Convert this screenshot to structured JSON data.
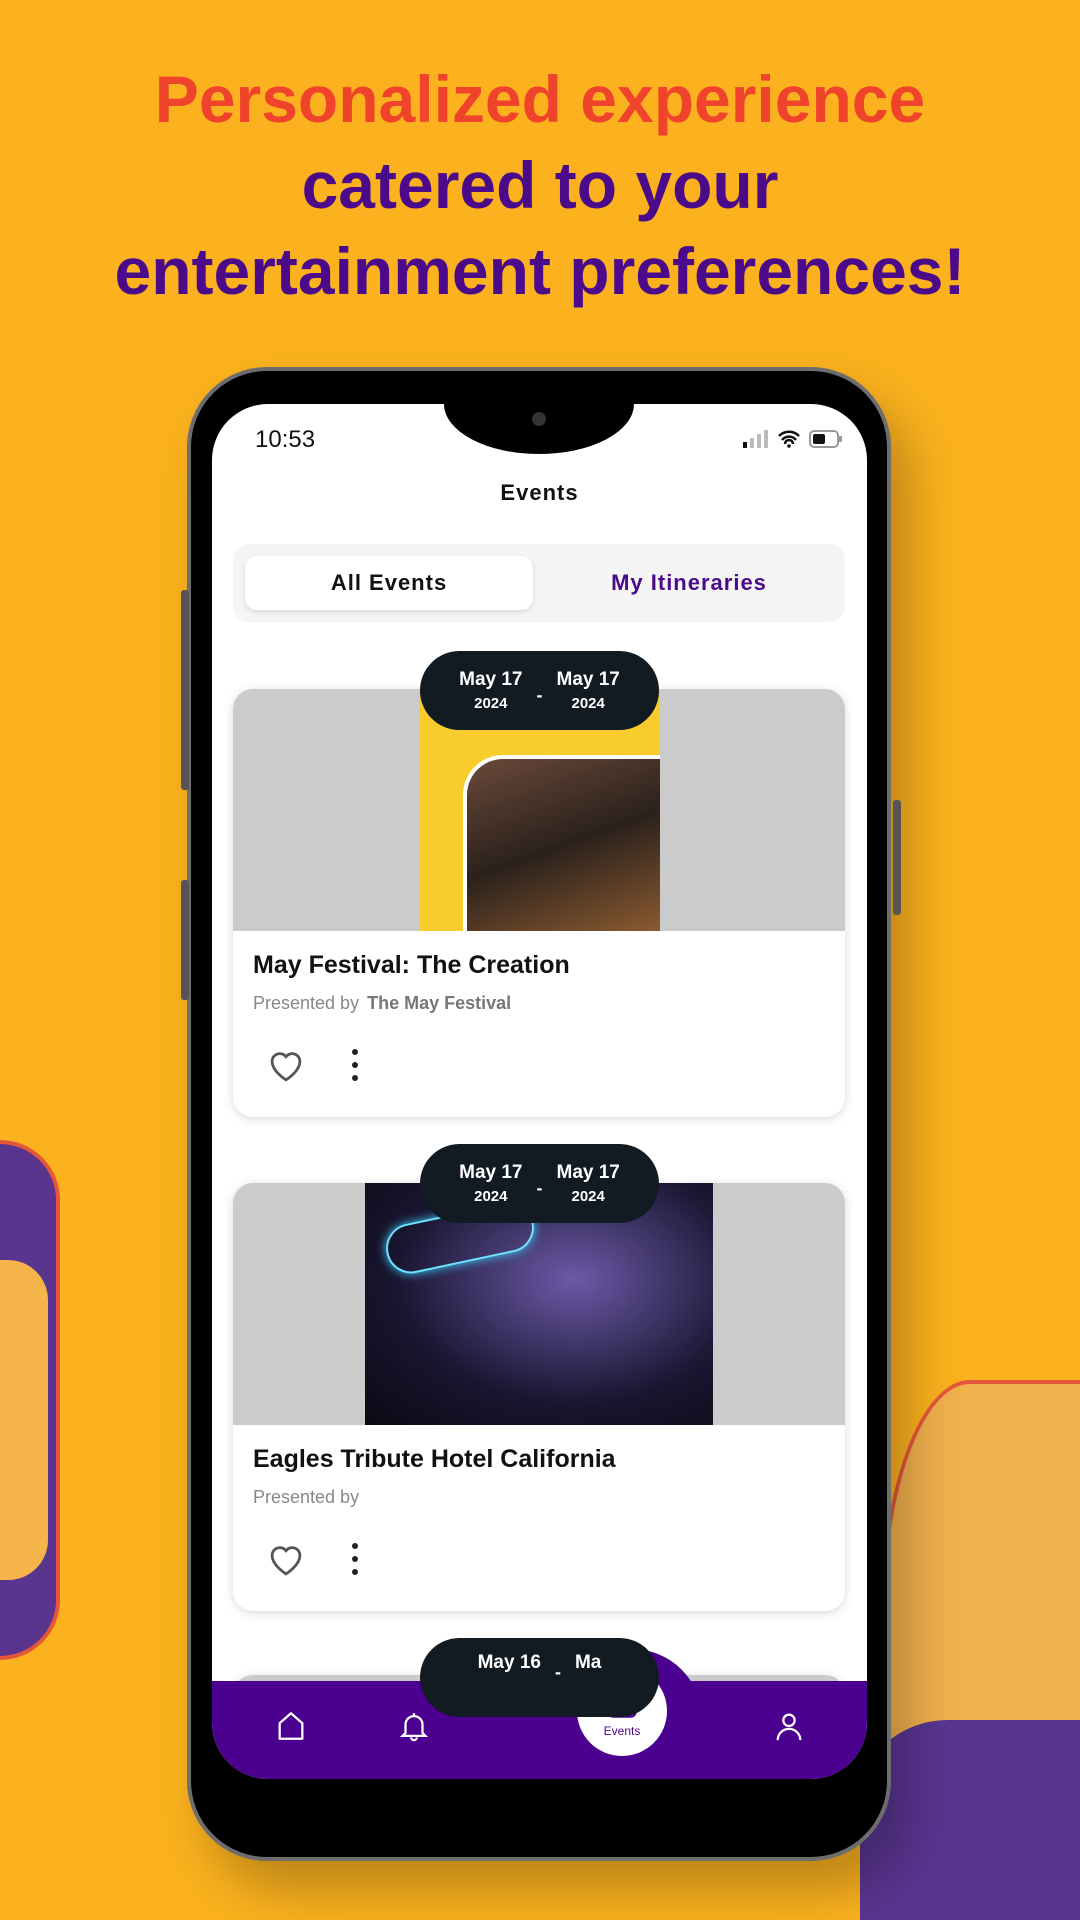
{
  "headline": {
    "line1": "Personalized experience",
    "line2": "catered to your",
    "line3": "entertainment preferences!"
  },
  "status_bar": {
    "time": "10:53"
  },
  "header": {
    "title": "Events"
  },
  "tabs": [
    {
      "label": "All Events",
      "active": true
    },
    {
      "label": "My Itineraries",
      "active": false
    }
  ],
  "events": [
    {
      "start_month_day": "May 17",
      "start_year": "2024",
      "end_month_day": "May 17",
      "end_year": "2024",
      "title": "May Festival: The Creation",
      "presented_by_label": "Presented by",
      "presenter": "The May Festival"
    },
    {
      "start_month_day": "May 17",
      "start_year": "2024",
      "end_month_day": "May 17",
      "end_year": "2024",
      "title": "Eagles Tribute Hotel California",
      "presented_by_label": "Presented by",
      "presenter": ""
    },
    {
      "start_month_day": "May 16",
      "end_month_day": "Ma"
    }
  ],
  "bottom_nav": {
    "items": [
      {
        "icon": "home-icon"
      },
      {
        "icon": "bell-icon"
      },
      {
        "icon": "calendar-icon",
        "label": "Events",
        "active": true
      },
      {
        "icon": "user-icon"
      }
    ]
  },
  "colors": {
    "background": "#fbb21e",
    "headline_accent": "#f0432c",
    "brand_purple": "#4b0090",
    "pill": "#121a22"
  }
}
